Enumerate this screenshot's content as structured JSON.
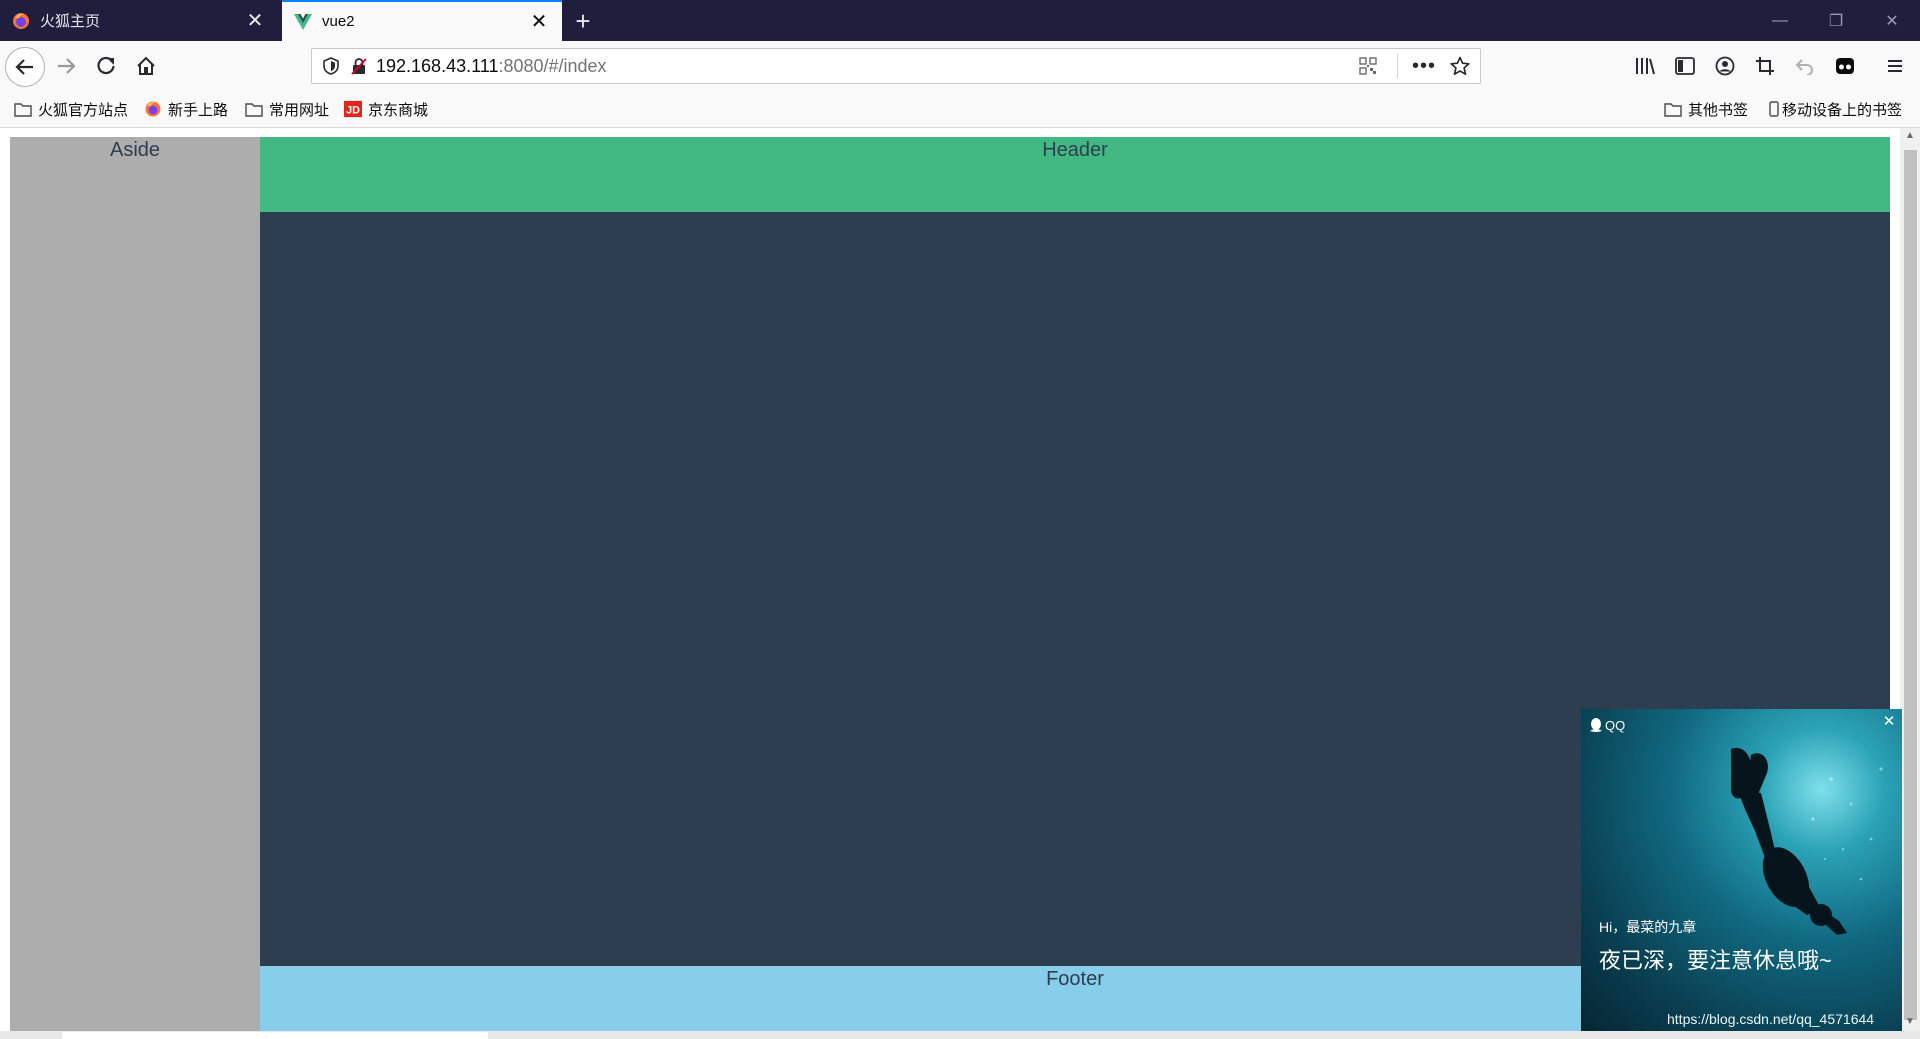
{
  "browser": {
    "tabs": [
      {
        "title": "火狐主页",
        "active": false,
        "icon": "firefox-icon"
      },
      {
        "title": "vue2",
        "active": true,
        "icon": "vue-icon"
      }
    ],
    "url_host": "192.168.43.111",
    "url_path": ":8080/#/index"
  },
  "bookmarks": {
    "left": [
      {
        "label": "火狐官方站点",
        "icon": "folder-icon"
      },
      {
        "label": "新手上路",
        "icon": "firefox-icon"
      },
      {
        "label": "常用网址",
        "icon": "folder-icon"
      },
      {
        "label": "京东商城",
        "icon": "jd-icon"
      }
    ],
    "right": [
      {
        "label": "其他书签",
        "icon": "folder-icon"
      },
      {
        "label": "移动设备上的书签",
        "icon": "mobile-icon"
      }
    ]
  },
  "page": {
    "aside_label": "Aside",
    "header_label": "Header",
    "footer_label": "Footer",
    "colors": {
      "aside": "#adadad",
      "header": "#42b983",
      "main": "#2c3e50",
      "footer": "#87ceeb"
    }
  },
  "qq_popup": {
    "app_name": "QQ",
    "greeting": "Hi，最菜的九章",
    "message": "夜已深，要注意休息哦~",
    "watermark": "https://blog.csdn.net/qq_4571644"
  }
}
